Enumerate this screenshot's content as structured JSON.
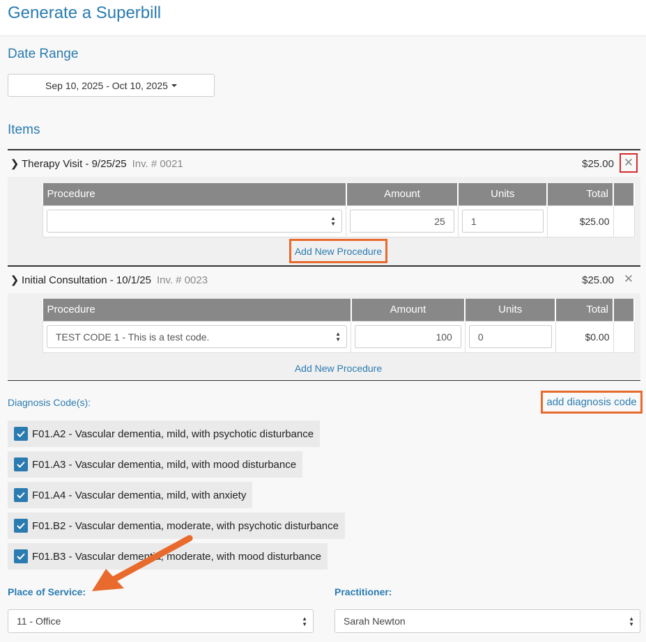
{
  "page": {
    "title": "Generate a Superbill"
  },
  "date_range": {
    "heading": "Date Range",
    "value": "Sep 10, 2025 - Oct 10, 2025"
  },
  "items_section": {
    "heading": "Items"
  },
  "items": [
    {
      "title": "Therapy Visit - 9/25/25",
      "invoice": "Inv. # 0021",
      "amount": "$25.00",
      "columns": {
        "procedure": "Procedure",
        "amount": "Amount",
        "units": "Units",
        "total": "Total"
      },
      "row": {
        "procedure": "",
        "amount": "25",
        "units": "1",
        "total": "$25.00"
      },
      "add_label": "Add New Procedure"
    },
    {
      "title": "Initial Consultation - 10/1/25",
      "invoice": "Inv. # 0023",
      "amount": "$25.00",
      "columns": {
        "procedure": "Procedure",
        "amount": "Amount",
        "units": "Units",
        "total": "Total"
      },
      "row": {
        "procedure": "TEST CODE 1 - This is a test code.",
        "amount": "100",
        "units": "0",
        "total": "$0.00"
      },
      "add_label": "Add New Procedure"
    }
  ],
  "diagnosis": {
    "label": "Diagnosis Code(s):",
    "add_label": "add diagnosis code",
    "codes": [
      "F01.A2 - Vascular dementia, mild, with psychotic disturbance",
      "F01.A3 - Vascular dementia, mild, with mood disturbance",
      "F01.A4 - Vascular dementia, mild, with anxiety",
      "F01.B2 - Vascular dementia, moderate, with psychotic disturbance",
      "F01.B3 - Vascular dementia, moderate, with mood disturbance"
    ]
  },
  "place_of_service": {
    "label": "Place of Service:",
    "value": "11 - Office"
  },
  "practitioner": {
    "label": "Practitioner:",
    "value": "Sarah Newton"
  },
  "icons": {
    "remove": "close-icon",
    "expand": "chevron-right-icon",
    "check": "checkmark-icon",
    "select": "updown-arrows-icon"
  },
  "colors": {
    "accent": "#2a7bb0",
    "highlight": "#e86a2c",
    "remove_highlight": "#d62b2b",
    "table_header": "#888888"
  }
}
